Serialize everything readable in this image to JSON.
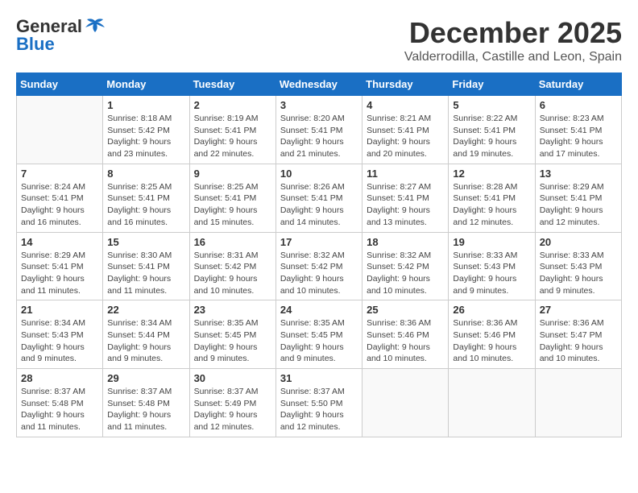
{
  "header": {
    "logo_general": "General",
    "logo_blue": "Blue",
    "month_title": "December 2025",
    "location": "Valderrodilla, Castille and Leon, Spain"
  },
  "weekdays": [
    "Sunday",
    "Monday",
    "Tuesday",
    "Wednesday",
    "Thursday",
    "Friday",
    "Saturday"
  ],
  "weeks": [
    [
      {
        "day": "",
        "info": ""
      },
      {
        "day": "1",
        "info": "Sunrise: 8:18 AM\nSunset: 5:42 PM\nDaylight: 9 hours\nand 23 minutes."
      },
      {
        "day": "2",
        "info": "Sunrise: 8:19 AM\nSunset: 5:41 PM\nDaylight: 9 hours\nand 22 minutes."
      },
      {
        "day": "3",
        "info": "Sunrise: 8:20 AM\nSunset: 5:41 PM\nDaylight: 9 hours\nand 21 minutes."
      },
      {
        "day": "4",
        "info": "Sunrise: 8:21 AM\nSunset: 5:41 PM\nDaylight: 9 hours\nand 20 minutes."
      },
      {
        "day": "5",
        "info": "Sunrise: 8:22 AM\nSunset: 5:41 PM\nDaylight: 9 hours\nand 19 minutes."
      },
      {
        "day": "6",
        "info": "Sunrise: 8:23 AM\nSunset: 5:41 PM\nDaylight: 9 hours\nand 17 minutes."
      }
    ],
    [
      {
        "day": "7",
        "info": "Sunrise: 8:24 AM\nSunset: 5:41 PM\nDaylight: 9 hours\nand 16 minutes."
      },
      {
        "day": "8",
        "info": "Sunrise: 8:25 AM\nSunset: 5:41 PM\nDaylight: 9 hours\nand 16 minutes."
      },
      {
        "day": "9",
        "info": "Sunrise: 8:25 AM\nSunset: 5:41 PM\nDaylight: 9 hours\nand 15 minutes."
      },
      {
        "day": "10",
        "info": "Sunrise: 8:26 AM\nSunset: 5:41 PM\nDaylight: 9 hours\nand 14 minutes."
      },
      {
        "day": "11",
        "info": "Sunrise: 8:27 AM\nSunset: 5:41 PM\nDaylight: 9 hours\nand 13 minutes."
      },
      {
        "day": "12",
        "info": "Sunrise: 8:28 AM\nSunset: 5:41 PM\nDaylight: 9 hours\nand 12 minutes."
      },
      {
        "day": "13",
        "info": "Sunrise: 8:29 AM\nSunset: 5:41 PM\nDaylight: 9 hours\nand 12 minutes."
      }
    ],
    [
      {
        "day": "14",
        "info": "Sunrise: 8:29 AM\nSunset: 5:41 PM\nDaylight: 9 hours\nand 11 minutes."
      },
      {
        "day": "15",
        "info": "Sunrise: 8:30 AM\nSunset: 5:41 PM\nDaylight: 9 hours\nand 11 minutes."
      },
      {
        "day": "16",
        "info": "Sunrise: 8:31 AM\nSunset: 5:42 PM\nDaylight: 9 hours\nand 10 minutes."
      },
      {
        "day": "17",
        "info": "Sunrise: 8:32 AM\nSunset: 5:42 PM\nDaylight: 9 hours\nand 10 minutes."
      },
      {
        "day": "18",
        "info": "Sunrise: 8:32 AM\nSunset: 5:42 PM\nDaylight: 9 hours\nand 10 minutes."
      },
      {
        "day": "19",
        "info": "Sunrise: 8:33 AM\nSunset: 5:43 PM\nDaylight: 9 hours\nand 9 minutes."
      },
      {
        "day": "20",
        "info": "Sunrise: 8:33 AM\nSunset: 5:43 PM\nDaylight: 9 hours\nand 9 minutes."
      }
    ],
    [
      {
        "day": "21",
        "info": "Sunrise: 8:34 AM\nSunset: 5:43 PM\nDaylight: 9 hours\nand 9 minutes."
      },
      {
        "day": "22",
        "info": "Sunrise: 8:34 AM\nSunset: 5:44 PM\nDaylight: 9 hours\nand 9 minutes."
      },
      {
        "day": "23",
        "info": "Sunrise: 8:35 AM\nSunset: 5:45 PM\nDaylight: 9 hours\nand 9 minutes."
      },
      {
        "day": "24",
        "info": "Sunrise: 8:35 AM\nSunset: 5:45 PM\nDaylight: 9 hours\nand 9 minutes."
      },
      {
        "day": "25",
        "info": "Sunrise: 8:36 AM\nSunset: 5:46 PM\nDaylight: 9 hours\nand 10 minutes."
      },
      {
        "day": "26",
        "info": "Sunrise: 8:36 AM\nSunset: 5:46 PM\nDaylight: 9 hours\nand 10 minutes."
      },
      {
        "day": "27",
        "info": "Sunrise: 8:36 AM\nSunset: 5:47 PM\nDaylight: 9 hours\nand 10 minutes."
      }
    ],
    [
      {
        "day": "28",
        "info": "Sunrise: 8:37 AM\nSunset: 5:48 PM\nDaylight: 9 hours\nand 11 minutes."
      },
      {
        "day": "29",
        "info": "Sunrise: 8:37 AM\nSunset: 5:48 PM\nDaylight: 9 hours\nand 11 minutes."
      },
      {
        "day": "30",
        "info": "Sunrise: 8:37 AM\nSunset: 5:49 PM\nDaylight: 9 hours\nand 12 minutes."
      },
      {
        "day": "31",
        "info": "Sunrise: 8:37 AM\nSunset: 5:50 PM\nDaylight: 9 hours\nand 12 minutes."
      },
      {
        "day": "",
        "info": ""
      },
      {
        "day": "",
        "info": ""
      },
      {
        "day": "",
        "info": ""
      }
    ]
  ]
}
